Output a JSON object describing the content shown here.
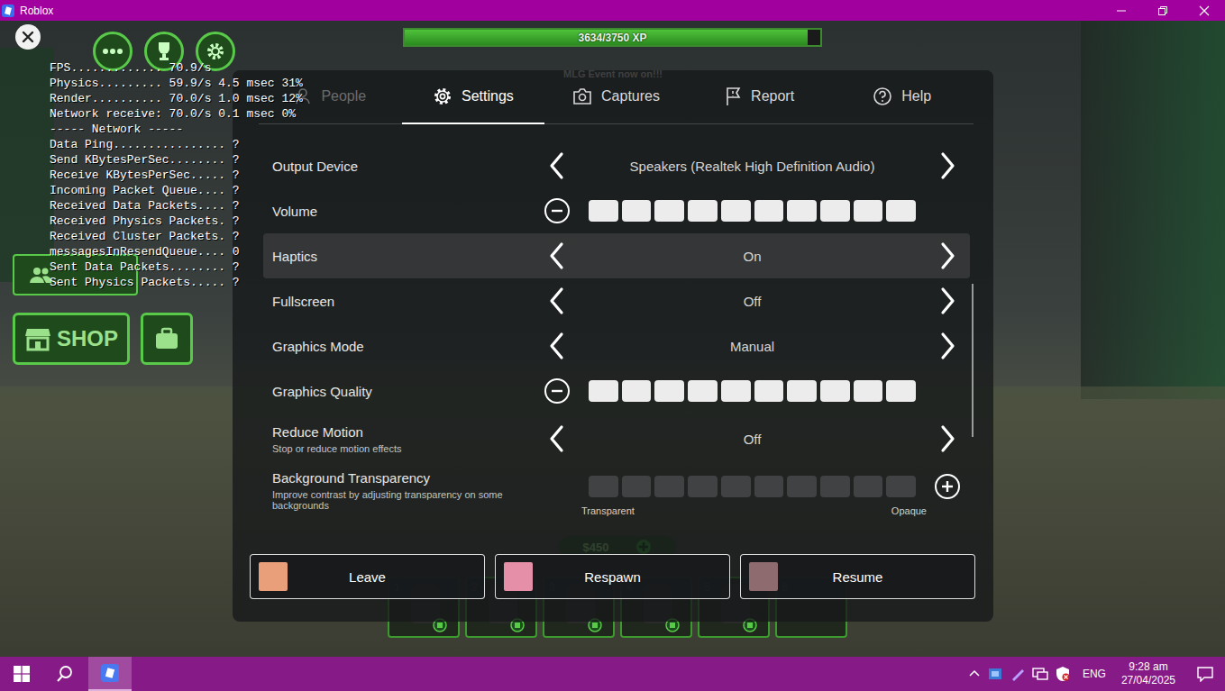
{
  "window": {
    "title": "Roblox"
  },
  "stats": [
    "FPS............. 70.9/s",
    "Physics......... 59.9/s 4.5 msec 31%",
    "Render.......... 70.0/s 1.0 msec 12%",
    "Network receive: 70.0/s 0.1 msec 0%",
    "----- Network -----",
    "Data Ping................ ?",
    "Send KBytesPerSec........ ?",
    "Receive KBytesPerSec..... ?",
    "Incoming Packet Queue.... ?",
    "Received Data Packets.... ?",
    "Received Physics Packets. ?",
    "Received Cluster Packets. ?",
    "messagesInResendQueue.... 0",
    "Sent Data Packets........ ?",
    "Sent Physics Packets..... ?"
  ],
  "xp_bar": {
    "text": "3634/3750 XP",
    "level": 0.969
  },
  "event_banner": "MLG Event now on!!!",
  "shop_button": "SHOP",
  "money": "$450",
  "hotbar": [
    {
      "slot": "1",
      "filled": true
    },
    {
      "slot": "2",
      "filled": true
    },
    {
      "slot": "3",
      "filled": true
    },
    {
      "slot": "4",
      "filled": true
    },
    {
      "slot": "5",
      "filled": true
    },
    {
      "slot": "6",
      "filled": false
    }
  ],
  "menu": {
    "tabs": [
      {
        "label": "People",
        "selected": false,
        "disabled": true
      },
      {
        "label": "Settings",
        "selected": true,
        "disabled": false
      },
      {
        "label": "Captures",
        "selected": false,
        "disabled": false
      },
      {
        "label": "Report",
        "selected": false,
        "disabled": false
      },
      {
        "label": "Help",
        "selected": false,
        "disabled": false
      }
    ],
    "settings": [
      {
        "kind": "selector",
        "label": "Output Device",
        "value": "Speakers (Realtek High Definition Audio)",
        "focused": false
      },
      {
        "kind": "slider",
        "label": "Volume",
        "level": 1,
        "focused": false
      },
      {
        "kind": "selector",
        "label": "Haptics",
        "value": "On",
        "focused": true
      },
      {
        "kind": "selector",
        "label": "Fullscreen",
        "value": "Off",
        "focused": false
      },
      {
        "kind": "selector",
        "label": "Graphics Mode",
        "value": "Manual",
        "focused": false
      },
      {
        "kind": "slider",
        "label": "Graphics Quality",
        "level": 1,
        "focused": false
      },
      {
        "kind": "selector",
        "label": "Reduce Motion",
        "description": "Stop or reduce motion effects",
        "value": "Off",
        "focused": false
      },
      {
        "kind": "slider",
        "label": "Background Transparency",
        "description": "Improve contrast by adjusting transparency on some backgrounds",
        "level": 0,
        "min_label": "Transparent",
        "max_label": "Opaque",
        "focused": false
      }
    ],
    "actions": [
      {
        "label": "Leave"
      },
      {
        "label": "Respawn"
      },
      {
        "label": "Resume"
      }
    ]
  },
  "taskbar": {
    "apps": [
      {
        "active": true
      }
    ],
    "language": "ENG",
    "time": "9:28 am",
    "date": "27/04/2025"
  }
}
